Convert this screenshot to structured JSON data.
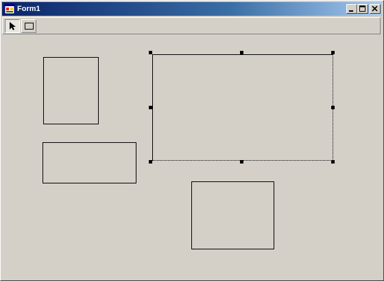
{
  "window": {
    "title": "Form1",
    "icons": {
      "app": "form-app-icon",
      "minimize": "minimize-icon",
      "maximize": "maximize-icon",
      "close": "close-icon"
    }
  },
  "toolbar": {
    "tools": [
      {
        "id": "pointer",
        "icon": "pointer-arrow-icon",
        "selected": true
      },
      {
        "id": "rectangle",
        "icon": "rectangle-icon",
        "selected": false
      }
    ]
  },
  "canvas": {
    "shapes": [
      {
        "id": "rectangle-1",
        "selected": false
      },
      {
        "id": "rectangle-2",
        "selected": false
      },
      {
        "id": "rectangle-3",
        "selected": true
      },
      {
        "id": "rectangle-4",
        "selected": false
      }
    ]
  },
  "colors": {
    "face": "#d4d0c8",
    "title_start": "#0a246a",
    "title_end": "#a6caf0",
    "title_text": "#ffffff",
    "shape_stroke": "#000000"
  }
}
